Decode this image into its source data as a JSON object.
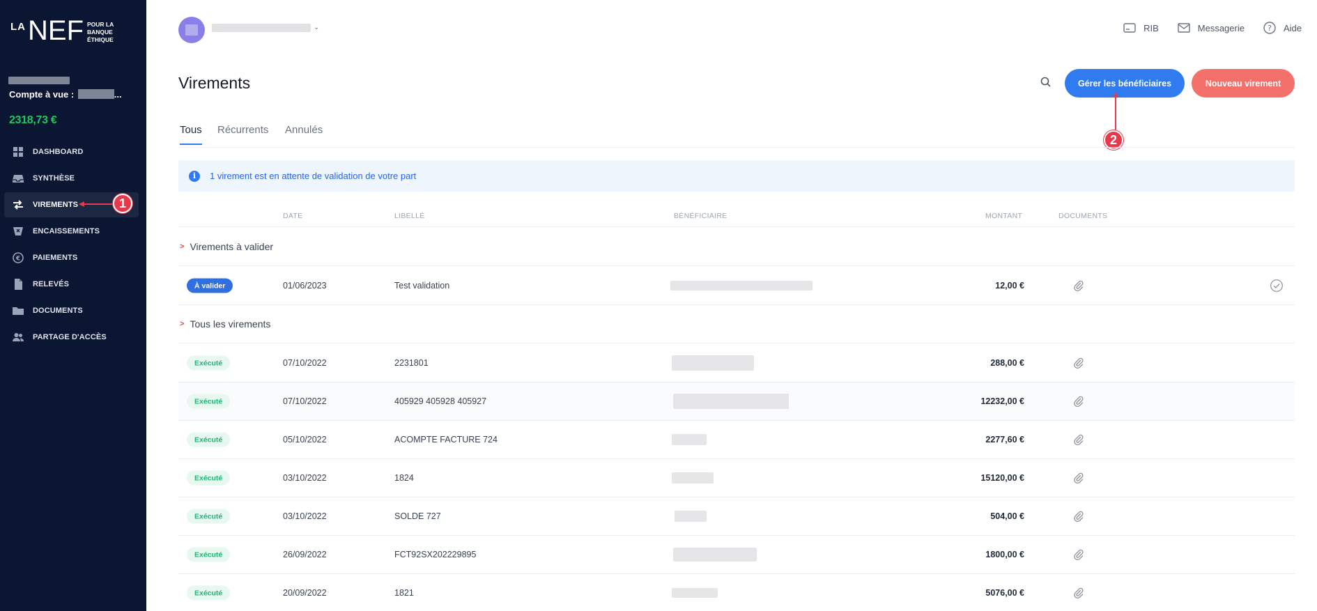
{
  "sidebar": {
    "logo": {
      "la": "LA",
      "nef": "NEF",
      "tagline": "POUR LA BANQUE ÉTHIQUE"
    },
    "account_label": "Compte à vue : ",
    "account_suffix": "...",
    "balance": "2318,73 €",
    "items": [
      {
        "label": "DASHBOARD",
        "icon": "dashboard-icon",
        "active": false
      },
      {
        "label": "SYNTHÈSE",
        "icon": "inbox-icon",
        "active": false
      },
      {
        "label": "VIREMENTS",
        "icon": "transfer-arrows-icon",
        "active": true
      },
      {
        "label": "ENCAISSEMENTS",
        "icon": "deposit-icon",
        "active": false
      },
      {
        "label": "PAIEMENTS",
        "icon": "euro-payment-icon",
        "active": false
      },
      {
        "label": "RELEVÉS",
        "icon": "file-icon",
        "active": false
      },
      {
        "label": "DOCUMENTS",
        "icon": "folder-icon",
        "active": false
      },
      {
        "label": "PARTAGE D'ACCÈS",
        "icon": "users-icon",
        "active": false
      }
    ]
  },
  "markers": {
    "m1": "1",
    "m2": "2"
  },
  "topbar": {
    "links": {
      "rib": "RIB",
      "messagerie": "Messagerie",
      "aide": "Aide"
    }
  },
  "page": {
    "title": "Virements",
    "manage_button": "Gérer les bénéficiaires",
    "new_button": "Nouveau virement"
  },
  "tabs": {
    "all": "Tous",
    "recurring": "Récurrents",
    "cancelled": "Annulés"
  },
  "banner": {
    "text": "1 virement est en attente de validation de votre part"
  },
  "table": {
    "headers": {
      "date": "DATE",
      "label": "LIBELLÉ",
      "beneficiary": "BÉNÉFICIAIRE",
      "amount": "MONTANT",
      "documents": "DOCUMENTS"
    },
    "group_pending": "Virements à valider",
    "group_all": "Tous les virements",
    "pending": [
      {
        "status": "À valider",
        "date": "01/06/2023",
        "label": "Test validation",
        "amount": "12,00 €"
      }
    ],
    "rows": [
      {
        "status": "Exécuté",
        "date": "07/10/2022",
        "label": "2231801",
        "amount": "288,00 €"
      },
      {
        "status": "Exécuté",
        "date": "07/10/2022",
        "label": "405929 405928 405927",
        "amount": "12232,00 €"
      },
      {
        "status": "Exécuté",
        "date": "05/10/2022",
        "label": "ACOMPTE FACTURE 724",
        "amount": "2277,60 €"
      },
      {
        "status": "Exécuté",
        "date": "03/10/2022",
        "label": "1824",
        "amount": "15120,00 €"
      },
      {
        "status": "Exécuté",
        "date": "03/10/2022",
        "label": "SOLDE 727",
        "amount": "504,00 €"
      },
      {
        "status": "Exécuté",
        "date": "26/09/2022",
        "label": "FCT92SX202229895",
        "amount": "1800,00 €"
      },
      {
        "status": "Exécuté",
        "date": "20/09/2022",
        "label": "1821",
        "amount": "5076,00 €"
      }
    ]
  }
}
